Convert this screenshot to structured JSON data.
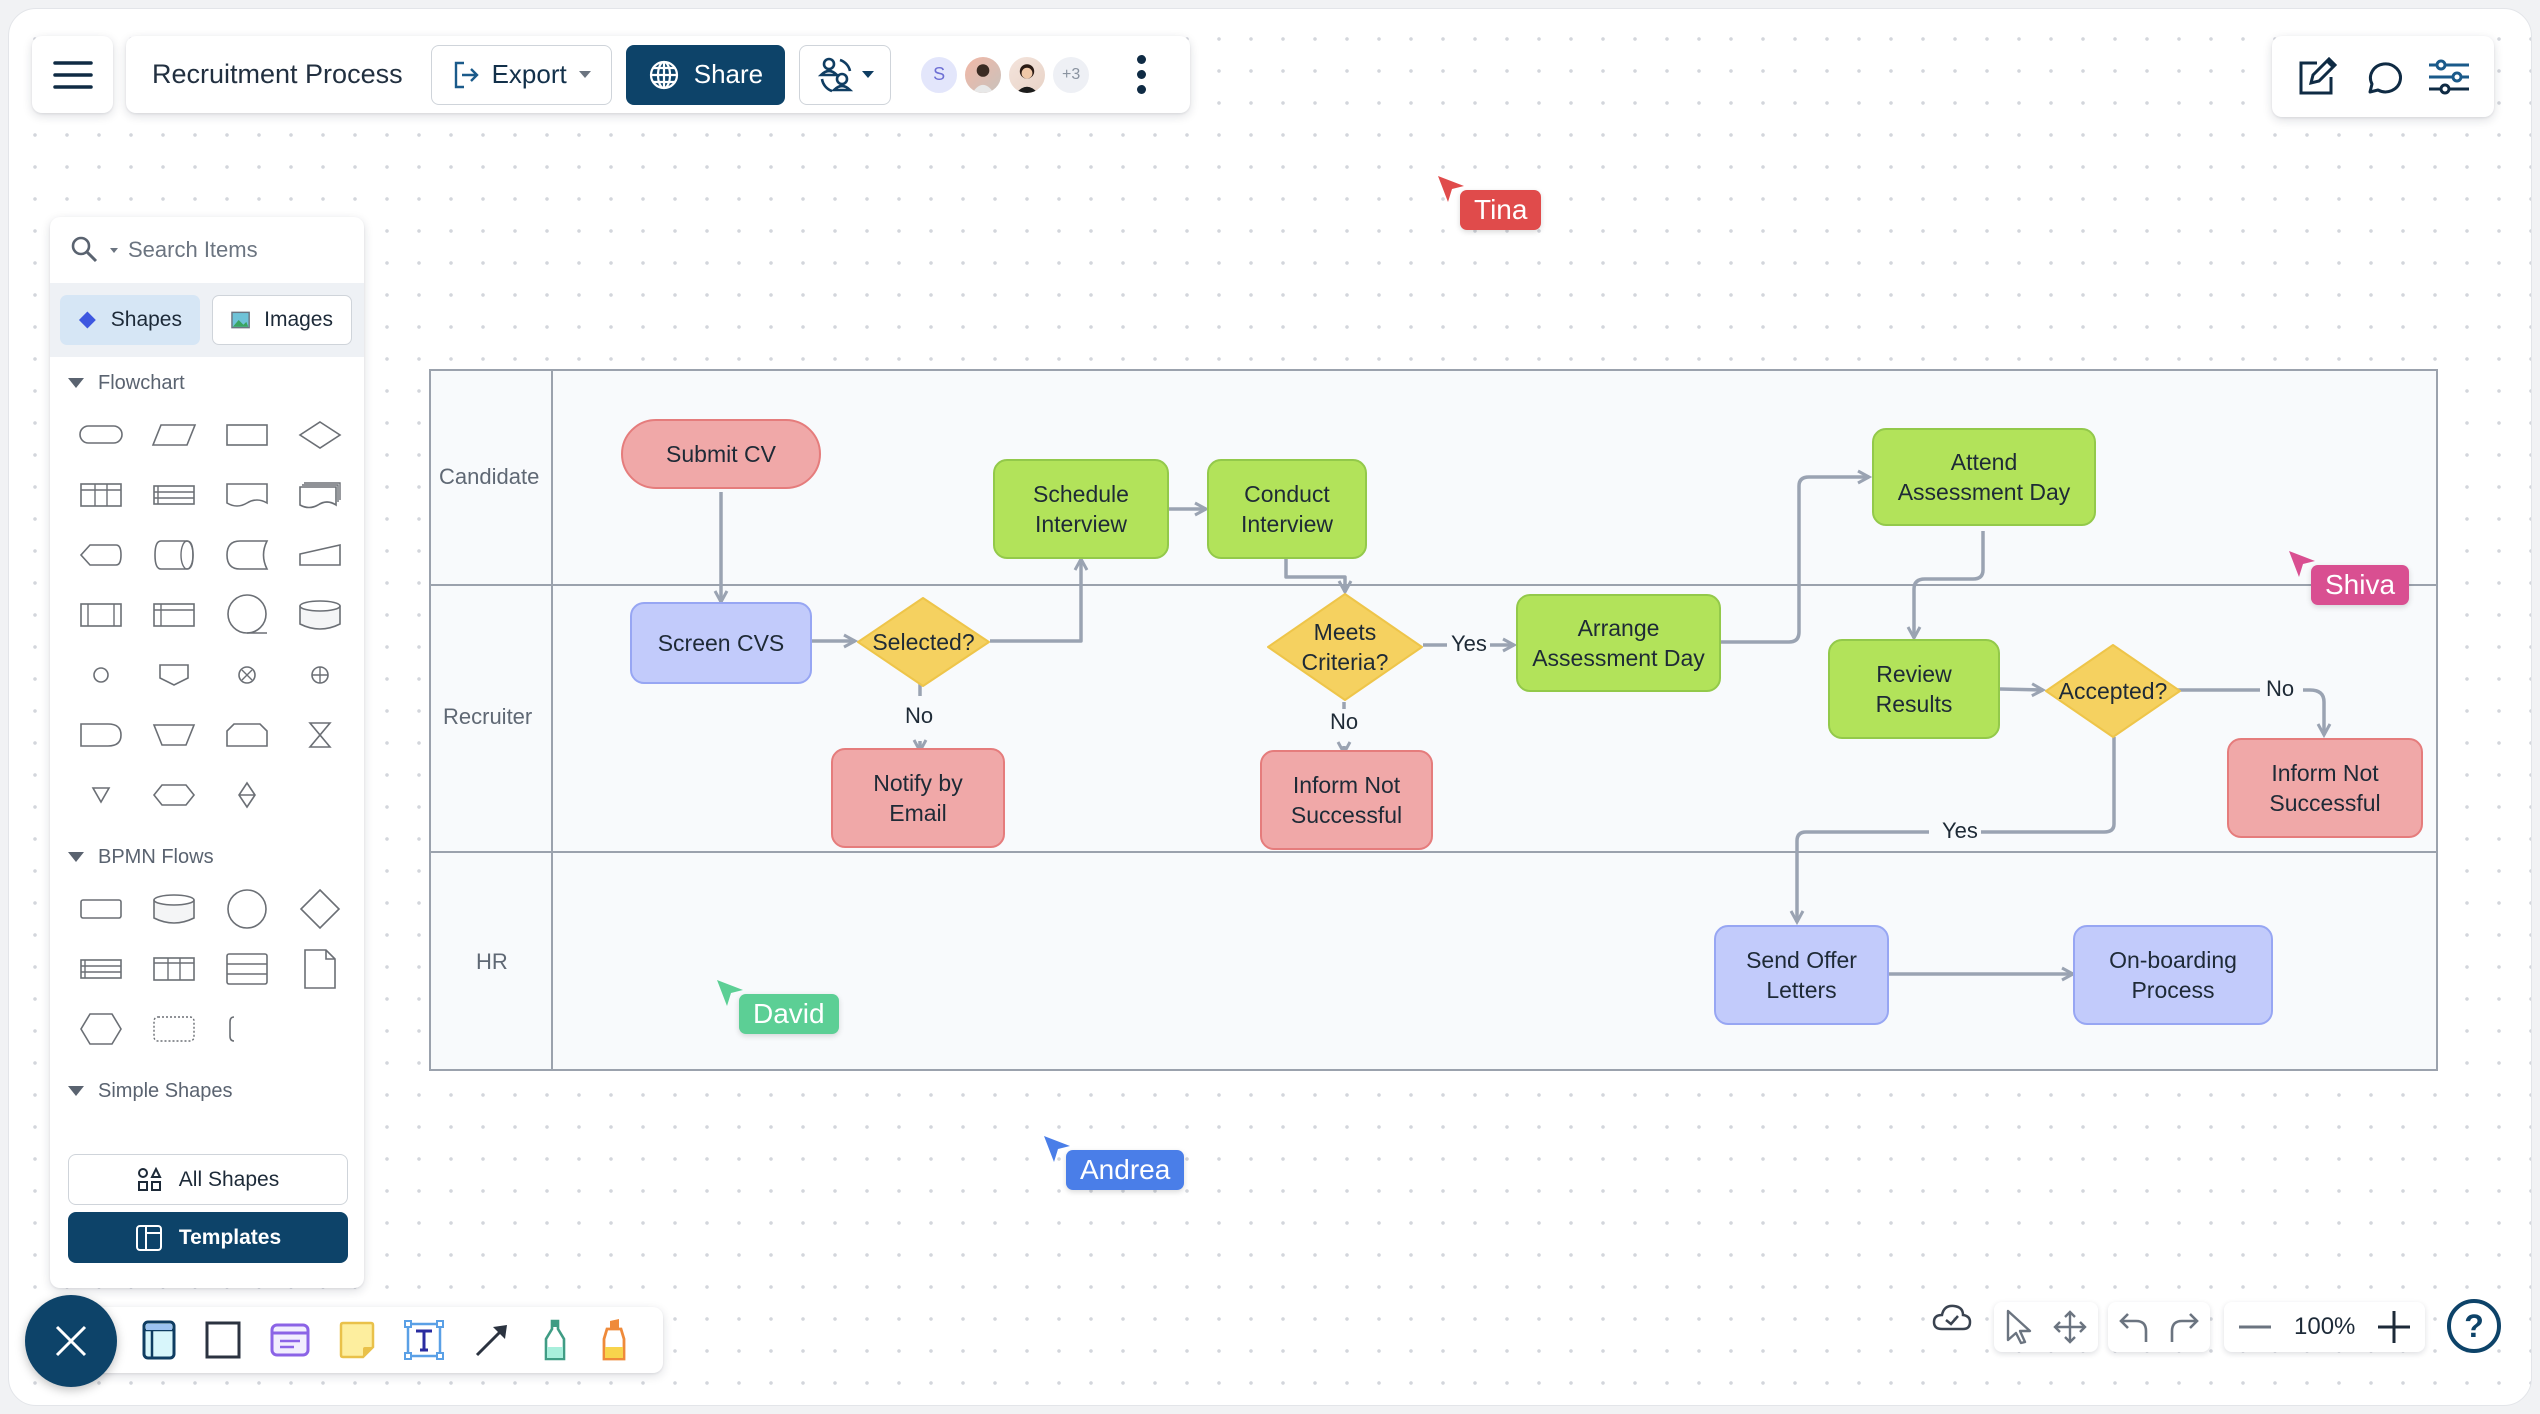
{
  "app": {
    "document_title": "Recruitment Process"
  },
  "header": {
    "menu_icon": "hamburger-menu-icon",
    "export_label": "Export",
    "share_label": "Share",
    "collaborators": [
      {
        "type": "initial",
        "label": "S"
      },
      {
        "type": "photo",
        "label": ""
      },
      {
        "type": "photo",
        "label": ""
      },
      {
        "type": "more",
        "label": "+3"
      }
    ]
  },
  "right_tools": [
    {
      "name": "edit-icon"
    },
    {
      "name": "comment-icon"
    },
    {
      "name": "settings-sliders-icon"
    }
  ],
  "left_panel": {
    "search_placeholder": "Search Items",
    "tabs": [
      {
        "label": "Shapes",
        "active": true
      },
      {
        "label": "Images",
        "active": false
      }
    ],
    "sections": [
      {
        "label": "Flowchart",
        "shape_count": 27
      },
      {
        "label": "BPMN Flows",
        "shape_count": 11
      },
      {
        "label": "Simple Shapes",
        "shape_count": 0
      }
    ],
    "all_shapes_label": "All Shapes",
    "templates_label": "Templates"
  },
  "diagram": {
    "lanes": [
      {
        "label": "Candidate"
      },
      {
        "label": "Recruiter"
      },
      {
        "label": "HR"
      }
    ],
    "nodes": {
      "submit_cv": "Submit CV",
      "screen_cvs": "Screen CVS",
      "selected": "Selected?",
      "notify_email": "Notify by\nEmail",
      "schedule_interview": "Schedule\nInterview",
      "conduct_interview": "Conduct\nInterview",
      "meets_criteria": "Meets\nCriteria?",
      "inform_not_successful_1": "Inform  Not\nSuccessful",
      "arrange_assessment": "Arrange\nAssessment Day",
      "attend_assessment": "Attend\nAssessment Day",
      "review_results": "Review\nResults",
      "accepted": "Accepted?",
      "inform_not_successful_2": "Inform  Not\nSuccessful",
      "send_offer": "Send Offer\nLetters",
      "onboarding": "On-boarding\nProcess"
    },
    "edge_labels": {
      "selected_no": "No",
      "criteria_yes": "Yes",
      "criteria_no": "No",
      "accepted_no": "No",
      "accepted_yes": "Yes"
    },
    "colors": {
      "red": "#f0a8a8",
      "green": "#b2e35a",
      "blue": "#c2cbfb",
      "yellow": "#f5d160",
      "edge": "#9aa3b2"
    }
  },
  "cursors": [
    {
      "name": "Tina",
      "color": "#e04b4b"
    },
    {
      "name": "Shiva",
      "color": "#d94f91"
    },
    {
      "name": "David",
      "color": "#5ccf95"
    },
    {
      "name": "Andrea",
      "color": "#4a7ee8"
    }
  ],
  "bottom_toolbar": {
    "tools": [
      "container-icon",
      "rectangle-icon",
      "card-icon",
      "sticky-note-icon",
      "text-icon",
      "arrow-connector-icon",
      "pen-icon",
      "highlighter-icon"
    ]
  },
  "bottom_right": {
    "zoom_level": "100%",
    "saved_status_icon": "cloud-saved-icon"
  }
}
